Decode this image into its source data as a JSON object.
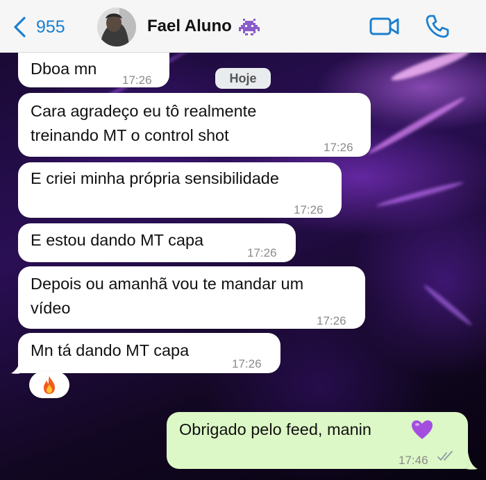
{
  "header": {
    "back_count": "955",
    "contact_name": "Fael Aluno",
    "contact_emoji": "alien-monster-icon"
  },
  "chat": {
    "date_chip": "Hoje",
    "messages": [
      {
        "text": "Dboa mn",
        "time": "17:26",
        "direction": "incoming"
      },
      {
        "text": "Cara agradeço eu tô realmente treinando MT o control shot",
        "line1": "Cara agradeço eu tô realmente",
        "line2": "treinando MT o control shot",
        "time": "17:26",
        "direction": "incoming"
      },
      {
        "text": "E criei minha própria sensibilidade",
        "time": "17:26",
        "direction": "incoming"
      },
      {
        "text": "E estou dando MT capa",
        "time": "17:26",
        "direction": "incoming"
      },
      {
        "text": "Depois ou amanhã vou te mandar um vídeo",
        "line1": "Depois ou amanhã vou te mandar um",
        "line2": "vídeo",
        "time": "17:26",
        "direction": "incoming"
      },
      {
        "text": "Mn tá dando MT capa",
        "time": "17:26",
        "direction": "incoming",
        "reaction": "fire-icon"
      },
      {
        "text": "Obrigado pelo feed, manin",
        "emoji": "purple-heart-icon",
        "time": "17:46",
        "direction": "outgoing",
        "status": "read-double-check-icon"
      }
    ]
  },
  "colors": {
    "accent": "#1a7fd0",
    "incoming_bubble": "#ffffff",
    "outgoing_bubble": "#dcf8c6",
    "header_bg": "#f6f6f6"
  }
}
